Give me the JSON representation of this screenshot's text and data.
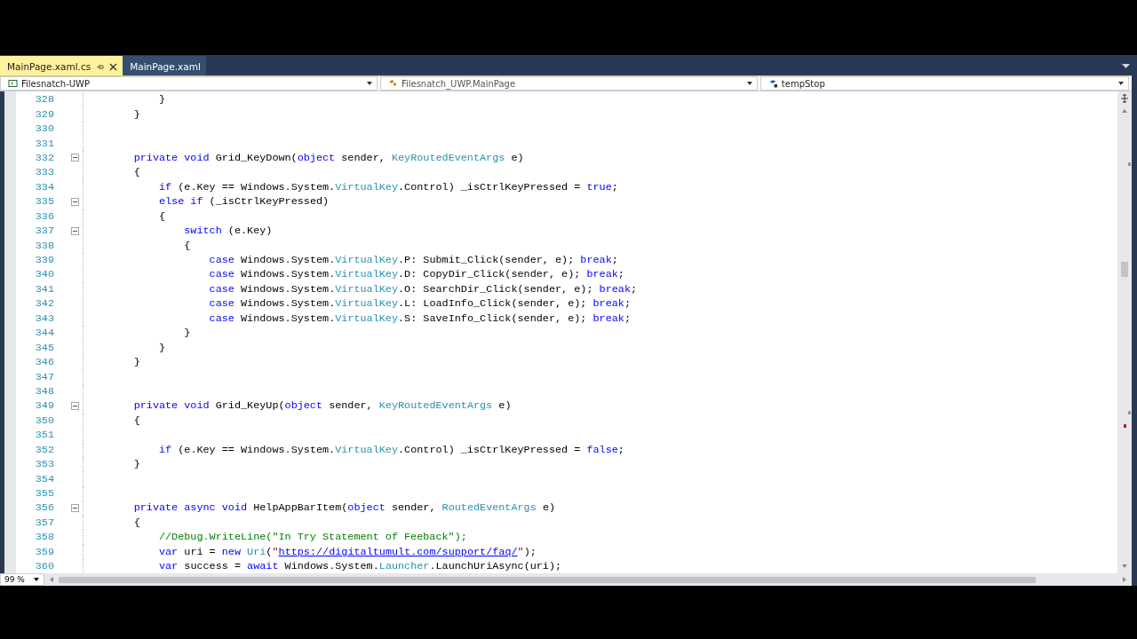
{
  "tabs": [
    {
      "label": "MainPage.xaml.cs",
      "selected": true,
      "pinned": true
    },
    {
      "label": "MainPage.xaml",
      "selected": false,
      "pinned": false
    }
  ],
  "nav_bar": [
    {
      "kind": "project",
      "label": "Filesnatch-UWP"
    },
    {
      "kind": "class",
      "label": "Filesnatch_UWP.MainPage"
    },
    {
      "kind": "field",
      "label": "tempStop"
    }
  ],
  "lines": [
    {
      "number": "328",
      "fold_marker": false,
      "tokens": [
        {
          "kind": "plain",
          "text": "            }"
        }
      ]
    },
    {
      "number": "329",
      "fold_marker": false,
      "tokens": [
        {
          "kind": "plain",
          "text": "        }"
        }
      ]
    },
    {
      "number": "330",
      "fold_marker": false
    },
    {
      "number": "331",
      "fold_marker": false
    },
    {
      "number": "332",
      "fold_marker": true,
      "expanded": true,
      "tokens": [
        {
          "kind": "keyword",
          "text": "        private void "
        },
        {
          "kind": "plain",
          "text": "Grid_KeyDown("
        },
        {
          "kind": "keyword",
          "text": "object"
        },
        {
          "kind": "plain",
          "text": " sender, "
        },
        {
          "kind": "type",
          "text": "KeyRoutedEventArgs"
        },
        {
          "kind": "plain",
          "text": " e)"
        }
      ]
    },
    {
      "number": "333",
      "fold_marker": false,
      "tokens": [
        {
          "kind": "plain",
          "text": "        {"
        }
      ]
    },
    {
      "number": "334",
      "fold_marker": false,
      "tokens": [
        {
          "kind": "keyword",
          "text": "            if"
        },
        {
          "kind": "plain",
          "text": " (e.Key == Windows.System."
        },
        {
          "kind": "type",
          "text": "VirtualKey"
        },
        {
          "kind": "plain",
          "text": ".Control) _isCtrlKeyPressed = "
        },
        {
          "kind": "keyword",
          "text": "true"
        },
        {
          "kind": "plain",
          "text": ";"
        }
      ]
    },
    {
      "number": "335",
      "fold_marker": true,
      "expanded": true,
      "tokens": [
        {
          "kind": "keyword",
          "text": "            else if"
        },
        {
          "kind": "plain",
          "text": " (_isCtrlKeyPressed)"
        }
      ]
    },
    {
      "number": "336",
      "fold_marker": false,
      "tokens": [
        {
          "kind": "plain",
          "text": "            {"
        }
      ]
    },
    {
      "number": "337",
      "fold_marker": true,
      "expanded": true,
      "tokens": [
        {
          "kind": "keyword",
          "text": "                switch"
        },
        {
          "kind": "plain",
          "text": " (e.Key)"
        }
      ]
    },
    {
      "number": "338",
      "fold_marker": false,
      "tokens": [
        {
          "kind": "plain",
          "text": "                {"
        }
      ]
    },
    {
      "number": "339",
      "fold_marker": false,
      "tokens": [
        {
          "kind": "keyword",
          "text": "                    case"
        },
        {
          "kind": "plain",
          "text": " Windows.System."
        },
        {
          "kind": "type",
          "text": "VirtualKey"
        },
        {
          "kind": "plain",
          "text": ".P: Submit_Click(sender, e); "
        },
        {
          "kind": "keyword",
          "text": "break"
        },
        {
          "kind": "plain",
          "text": ";"
        }
      ]
    },
    {
      "number": "340",
      "fold_marker": false,
      "tokens": [
        {
          "kind": "keyword",
          "text": "                    case"
        },
        {
          "kind": "plain",
          "text": " Windows.System."
        },
        {
          "kind": "type",
          "text": "VirtualKey"
        },
        {
          "kind": "plain",
          "text": ".D: CopyDir_Click(sender, e); "
        },
        {
          "kind": "keyword",
          "text": "break"
        },
        {
          "kind": "plain",
          "text": ";"
        }
      ]
    },
    {
      "number": "341",
      "fold_marker": false,
      "tokens": [
        {
          "kind": "keyword",
          "text": "                    case"
        },
        {
          "kind": "plain",
          "text": " Windows.System."
        },
        {
          "kind": "type",
          "text": "VirtualKey"
        },
        {
          "kind": "plain",
          "text": ".O: SearchDir_Click(sender, e); "
        },
        {
          "kind": "keyword",
          "text": "break"
        },
        {
          "kind": "plain",
          "text": ";"
        }
      ]
    },
    {
      "number": "342",
      "fold_marker": false,
      "tokens": [
        {
          "kind": "keyword",
          "text": "                    case"
        },
        {
          "kind": "plain",
          "text": " Windows.System."
        },
        {
          "kind": "type",
          "text": "VirtualKey"
        },
        {
          "kind": "plain",
          "text": ".L: LoadInfo_Click(sender, e); "
        },
        {
          "kind": "keyword",
          "text": "break"
        },
        {
          "kind": "plain",
          "text": ";"
        }
      ]
    },
    {
      "number": "343",
      "fold_marker": false,
      "tokens": [
        {
          "kind": "keyword",
          "text": "                    case"
        },
        {
          "kind": "plain",
          "text": " Windows.System."
        },
        {
          "kind": "type",
          "text": "VirtualKey"
        },
        {
          "kind": "plain",
          "text": ".S: SaveInfo_Click(sender, e); "
        },
        {
          "kind": "keyword",
          "text": "break"
        },
        {
          "kind": "plain",
          "text": ";"
        }
      ]
    },
    {
      "number": "344",
      "fold_marker": false,
      "tokens": [
        {
          "kind": "plain",
          "text": "                }"
        }
      ]
    },
    {
      "number": "345",
      "fold_marker": false,
      "tokens": [
        {
          "kind": "plain",
          "text": "            }"
        }
      ]
    },
    {
      "number": "346",
      "fold_marker": false,
      "tokens": [
        {
          "kind": "plain",
          "text": "        }"
        }
      ]
    },
    {
      "number": "347",
      "fold_marker": false
    },
    {
      "number": "348",
      "fold_marker": false
    },
    {
      "number": "349",
      "fold_marker": true,
      "expanded": true,
      "tokens": [
        {
          "kind": "keyword",
          "text": "        private void "
        },
        {
          "kind": "plain",
          "text": "Grid_KeyUp("
        },
        {
          "kind": "keyword",
          "text": "object"
        },
        {
          "kind": "plain",
          "text": " sender, "
        },
        {
          "kind": "type",
          "text": "KeyRoutedEventArgs"
        },
        {
          "kind": "plain",
          "text": " e)"
        }
      ]
    },
    {
      "number": "350",
      "fold_marker": false,
      "tokens": [
        {
          "kind": "plain",
          "text": "        {"
        }
      ]
    },
    {
      "number": "351",
      "fold_marker": false
    },
    {
      "number": "352",
      "fold_marker": false,
      "tokens": [
        {
          "kind": "keyword",
          "text": "            if"
        },
        {
          "kind": "plain",
          "text": " (e.Key == Windows.System."
        },
        {
          "kind": "type",
          "text": "VirtualKey"
        },
        {
          "kind": "plain",
          "text": ".Control) _isCtrlKeyPressed = "
        },
        {
          "kind": "keyword",
          "text": "false"
        },
        {
          "kind": "plain",
          "text": ";"
        }
      ]
    },
    {
      "number": "353",
      "fold_marker": false,
      "tokens": [
        {
          "kind": "plain",
          "text": "        }"
        }
      ]
    },
    {
      "number": "354",
      "fold_marker": false
    },
    {
      "number": "355",
      "fold_marker": false
    },
    {
      "number": "356",
      "fold_marker": true,
      "expanded": true,
      "tokens": [
        {
          "kind": "keyword",
          "text": "        private async void "
        },
        {
          "kind": "plain",
          "text": "HelpAppBarItem("
        },
        {
          "kind": "keyword",
          "text": "object"
        },
        {
          "kind": "plain",
          "text": " sender, "
        },
        {
          "kind": "type",
          "text": "RoutedEventArgs"
        },
        {
          "kind": "plain",
          "text": " e)"
        }
      ]
    },
    {
      "number": "357",
      "fold_marker": false,
      "tokens": [
        {
          "kind": "plain",
          "text": "        {"
        }
      ]
    },
    {
      "number": "358",
      "fold_marker": false,
      "tokens": [
        {
          "kind": "comment",
          "text": "            //Debug.WriteLine(\"In Try Statement of Feeback\");"
        }
      ]
    },
    {
      "number": "359",
      "fold_marker": false,
      "tokens": [
        {
          "kind": "keyword",
          "text": "            var"
        },
        {
          "kind": "plain",
          "text": " uri = "
        },
        {
          "kind": "keyword",
          "text": "new "
        },
        {
          "kind": "type",
          "text": "Uri"
        },
        {
          "kind": "plain",
          "text": "("
        },
        {
          "kind": "string",
          "text": "\""
        },
        {
          "kind": "link",
          "text": "https://digitaltumult.com/support/faq/"
        },
        {
          "kind": "string",
          "text": "\""
        },
        {
          "kind": "plain",
          "text": ");"
        }
      ]
    },
    {
      "number": "360",
      "fold_marker": false,
      "tokens": [
        {
          "kind": "keyword",
          "text": "            var"
        },
        {
          "kind": "plain",
          "text": " success = "
        },
        {
          "kind": "keyword",
          "text": "await"
        },
        {
          "kind": "plain",
          "text": " Windows.System."
        },
        {
          "kind": "type",
          "text": "Launcher"
        },
        {
          "kind": "plain",
          "text": ".LaunchUriAsync(uri);"
        }
      ]
    }
  ],
  "zoom": "99 %"
}
